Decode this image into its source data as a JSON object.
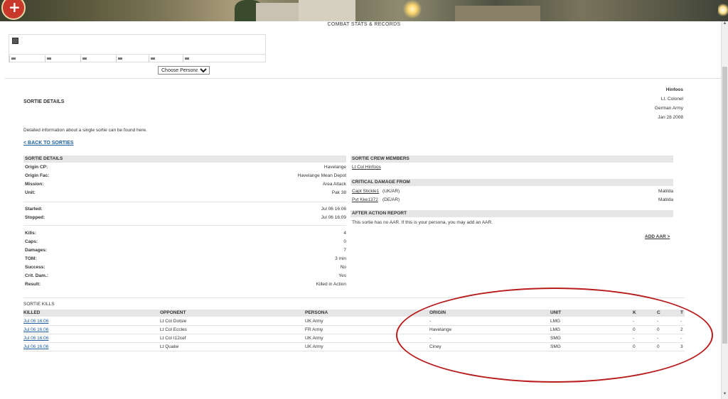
{
  "header": {
    "title": "COMBAT STATS & RECORDS"
  },
  "persona_select": {
    "value": "Choose Persona"
  },
  "profile": {
    "name": "Hinfoos",
    "rank": "Lt. Colonel",
    "army": "German Army",
    "date": "Jan 28 2008"
  },
  "section": {
    "title": "SORTIE DETAILS",
    "intro": "Detailed information about a single sortie can be found here.",
    "back_link": "< BACK TO SORTIES"
  },
  "sortie_details": {
    "header": "SORTIE DETAILS",
    "rows": [
      {
        "label": "Origin CP:",
        "value": "Havelange"
      },
      {
        "label": "Origin Fac:",
        "value": "Havelange Mean Depot"
      },
      {
        "label": "Mission:",
        "value": "Area Attack"
      },
      {
        "label": "Unit:",
        "value": "Pak 38"
      },
      {
        "label": "Started:",
        "value": "Jul 06 16:06"
      },
      {
        "label": "Stopped:",
        "value": "Jul 06 16:09"
      },
      {
        "label": "Kills:",
        "value": "4"
      },
      {
        "label": "Caps:",
        "value": "0"
      },
      {
        "label": "Damages:",
        "value": "7"
      },
      {
        "label": "TOM:",
        "value": "3 min"
      },
      {
        "label": "Success:",
        "value": "No"
      },
      {
        "label": "Crit. Dam.:",
        "value": "Yes"
      },
      {
        "label": "Result:",
        "value": "Killed in Action"
      }
    ]
  },
  "crew": {
    "header": "SORTIE CREW MEMBERS",
    "member": "Lt Col Hinfoos"
  },
  "critical_damage": {
    "header": "CRITICAL DAMAGE FROM",
    "rows": [
      {
        "name": "Capt Stickle1",
        "army": " (UK/AR)",
        "unit": "Matilda"
      },
      {
        "name": "Pvt Kke1372",
        "army": " (DE/AR)",
        "unit": "Matilda"
      }
    ]
  },
  "aar": {
    "header": "AFTER ACTION REPORT",
    "text": "This sortie has no AAR. If this is your persona, you may add an AAR.",
    "add_link": "ADD AAR >"
  },
  "kills": {
    "title": "SORTIE KILLS",
    "columns": [
      "KILLED",
      "OPPONENT",
      "PERSONA",
      "ORIGIN",
      "UNIT",
      "K",
      "C",
      "T"
    ],
    "rows": [
      {
        "killed": "Jul 06 16:06",
        "opponent": "Lt Col Dotsie",
        "persona": "UK Army",
        "origin": "-",
        "unit": "LMG",
        "k": "-",
        "c": "-",
        "t": "-"
      },
      {
        "killed": "Jul 06 16:06",
        "opponent": "Lt Col Eccles",
        "persona": "FR Army",
        "origin": "Havelange",
        "unit": "LMG",
        "k": "0",
        "c": "0",
        "t": "2"
      },
      {
        "killed": "Jul 06 16:06",
        "opponent": "Lt Col I12cef",
        "persona": "UK Army",
        "origin": "-",
        "unit": "SMG",
        "k": "-",
        "c": "-",
        "t": "-"
      },
      {
        "killed": "Jul 06 16:06",
        "opponent": "Lt Quake",
        "persona": "UK Army",
        "origin": "Ciney",
        "unit": "SMG",
        "k": "0",
        "c": "0",
        "t": "3"
      }
    ]
  },
  "annotation": {
    "color": "#b81d1d"
  }
}
